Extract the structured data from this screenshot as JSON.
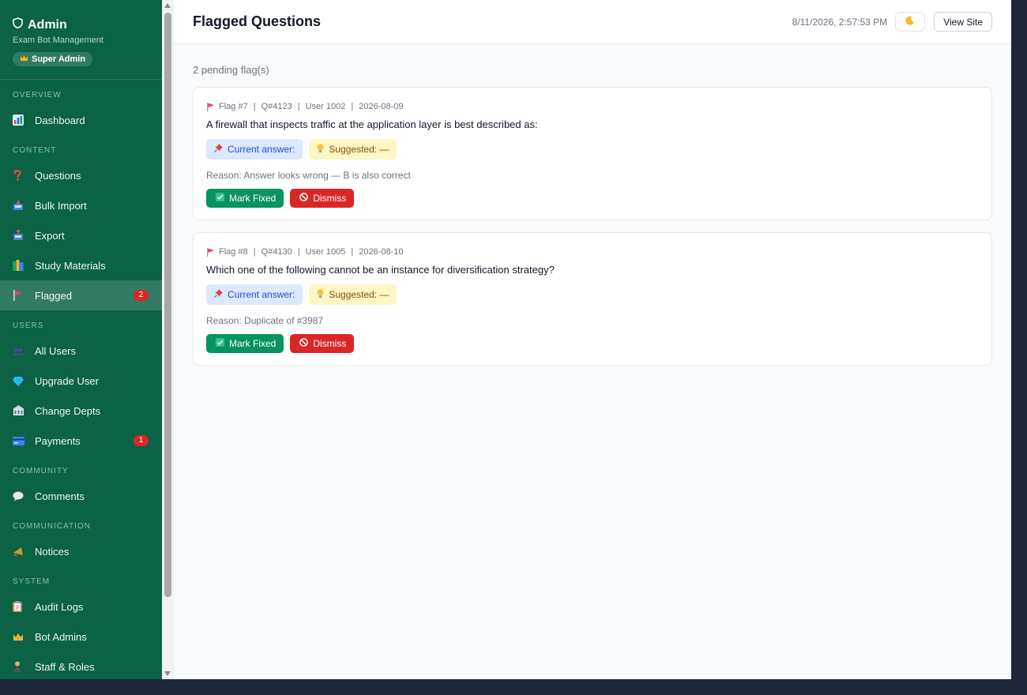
{
  "sidebar": {
    "brand_title": "Admin",
    "brand_subtitle": "Exam Bot Management",
    "role_badge": "Super Admin",
    "sections": {
      "overview": "OVERVIEW",
      "content": "CONTENT",
      "users": "USERS",
      "community": "COMMUNITY",
      "communication": "COMMUNICATION",
      "system": "SYSTEM"
    },
    "items": {
      "dashboard": "Dashboard",
      "questions": "Questions",
      "bulk_import": "Bulk Import",
      "export": "Export",
      "study_materials": "Study Materials",
      "flagged": "Flagged",
      "flagged_count": "2",
      "all_users": "All Users",
      "upgrade_user": "Upgrade User",
      "change_depts": "Change Depts",
      "payments": "Payments",
      "payments_count": "1",
      "comments": "Comments",
      "notices": "Notices",
      "audit_logs": "Audit Logs",
      "bot_admins": "Bot Admins",
      "staff_roles": "Staff & Roles"
    },
    "active_item": "Flagged"
  },
  "header": {
    "title": "Flagged Questions",
    "timestamp": "8/11/2026, 2:57:53 PM",
    "view_site": "View Site"
  },
  "main": {
    "pending_text": "2 pending flag(s)",
    "flags": [
      {
        "flag": "Flag #7",
        "question_id": "Q#4123",
        "user": "User 1002",
        "date": "2026-08-09",
        "question": "A firewall that inspects traffic at the application layer is best described as:",
        "current_answer": "Current answer:",
        "suggested": "Suggested: —",
        "reason": "Reason: Answer looks wrong — B is also correct",
        "mark_fixed": "Mark Fixed",
        "dismiss": "Dismiss"
      },
      {
        "flag": "Flag #8",
        "question_id": "Q#4130",
        "user": "User 1005",
        "date": "2026-08-10",
        "question": "Which one of the following cannot be an instance for diversification strategy?",
        "current_answer": "Current answer:",
        "suggested": "Suggested: —",
        "reason": "Reason: Duplicate of #3987",
        "mark_fixed": "Mark Fixed",
        "dismiss": "Dismiss"
      }
    ]
  },
  "colors": {
    "sidebar_bg": "#0b6244",
    "accent_green": "#089460",
    "danger_red": "#dc2626",
    "badge_red": "#e02424"
  },
  "icons": {
    "brand": "shield-icon",
    "role": "crown-icon",
    "theme_toggle": "moon-icon",
    "flag": "flag-icon",
    "current": "pin-icon",
    "suggested": "bulb-icon",
    "fix": "check-icon",
    "dismiss": "no-entry-icon"
  }
}
